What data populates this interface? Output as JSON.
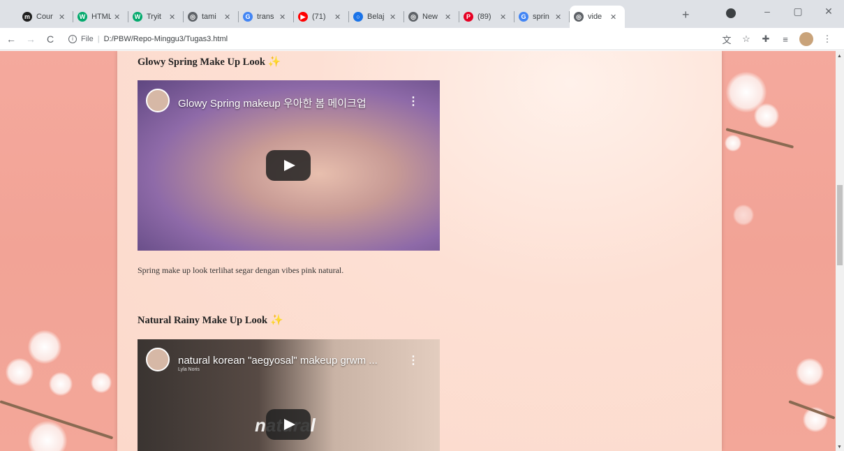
{
  "browser": {
    "tabs": [
      {
        "title": "Cour",
        "icon": "coursera-icon",
        "color": "#1f1f1f",
        "glyph": "m"
      },
      {
        "title": "HTML",
        "icon": "w3schools-icon",
        "color": "#04aa6d",
        "glyph": "W"
      },
      {
        "title": "Tryit",
        "icon": "w3schools-icon",
        "color": "#04aa6d",
        "glyph": "W"
      },
      {
        "title": "tami",
        "icon": "globe-icon",
        "color": "#5f6368",
        "glyph": "◎"
      },
      {
        "title": "trans",
        "icon": "google-icon",
        "color": "#4285f4",
        "glyph": "G"
      },
      {
        "title": "(71)",
        "icon": "youtube-icon",
        "color": "#ff0000",
        "glyph": "▶"
      },
      {
        "title": "Belaj",
        "icon": "circle-icon",
        "color": "#1a73e8",
        "glyph": "○"
      },
      {
        "title": "New",
        "icon": "globe-icon",
        "color": "#5f6368",
        "glyph": "◎"
      },
      {
        "title": "(89)",
        "icon": "pinterest-icon",
        "color": "#e60023",
        "glyph": "P"
      },
      {
        "title": "sprin",
        "icon": "google-icon",
        "color": "#4285f4",
        "glyph": "G"
      },
      {
        "title": "vide",
        "icon": "globe-icon",
        "color": "#5f6368",
        "glyph": "◎"
      }
    ],
    "new_tab": "+",
    "window_controls": {
      "minimize": "–",
      "maximize": "▢",
      "close": "✕"
    }
  },
  "toolbar": {
    "back": "←",
    "forward": "→",
    "reload": "C",
    "url_scheme": "File",
    "url_path": "D:/PBW/Repo-Minggu3/Tugas3.html"
  },
  "page": {
    "section1": {
      "title": "Glowy Spring Make Up Look",
      "sparkle": "✨",
      "video_title": "Glowy Spring makeup 우아한 봄 메이크업",
      "description": "Spring make up look terlihat segar dengan vibes pink natural."
    },
    "section2": {
      "title": "Natural Rainy Make Up Look",
      "sparkle": "✨",
      "video_title": "natural korean \"aegyosal\" makeup grwm ...",
      "channel": "Lyla Noris",
      "overlay_text": "natural"
    }
  },
  "colors": {
    "page_bg": "#f4a99d",
    "content_bg": "#fcd9cb",
    "video1_bg": "#7d5e99",
    "video2_bg": "#3b3633"
  }
}
